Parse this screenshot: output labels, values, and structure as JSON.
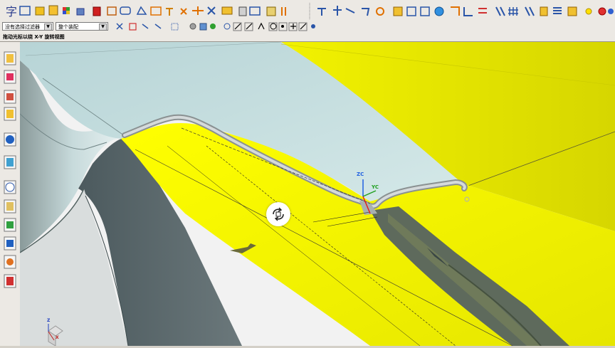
{
  "toolbar": {
    "icons": [
      "text-icon",
      "insert-icon",
      "block-icon",
      "extrude-icon",
      "color-icon",
      "layer-icon",
      "render-icon",
      "sketch-icon",
      "trim-icon",
      "blend-icon",
      "measure-icon",
      "dimension-icon",
      "note-icon",
      "fit-icon",
      "snapshot-icon",
      "table-icon",
      "move-icon",
      "curve-icon",
      "line-icon",
      "arc-icon",
      "circle-icon",
      "rectangle-icon",
      "point-icon",
      "mirror-icon",
      "pattern-icon",
      "shell-icon",
      "chamfer-icon",
      "offset-icon",
      "section-icon",
      "align-icon",
      "hole-icon",
      "grid-icon",
      "grid2-icon",
      "attribute-icon",
      "list-icon",
      "tint-icon",
      "view-icon"
    ]
  },
  "selection_bar": {
    "filter_value": "没有选择过滤器",
    "scope_value": "整个装配"
  },
  "status": {
    "prompt": "拖动光标以绕 X-Y 旋转视图"
  },
  "resource_bar": {
    "icons": [
      "assembly-navigator-icon",
      "constraint-navigator-icon",
      "part-navigator-icon",
      "reuse-library-icon",
      "internet-explorer-icon",
      "history-icon",
      "clock-icon",
      "process-studio-icon",
      "visualization-icon",
      "roles-icon",
      "system-materials-icon",
      "print-icon"
    ]
  },
  "viewport": {
    "wcs_labels": {
      "zc": "ZC",
      "yc": "YC"
    },
    "csys_labels": {
      "z": "Z",
      "x": "X"
    },
    "colors": {
      "face_yellow": "#ffff00",
      "face_teal": "#c5dfe0",
      "face_gray": "#5d6a6e",
      "background": "#f2f2f2"
    }
  }
}
